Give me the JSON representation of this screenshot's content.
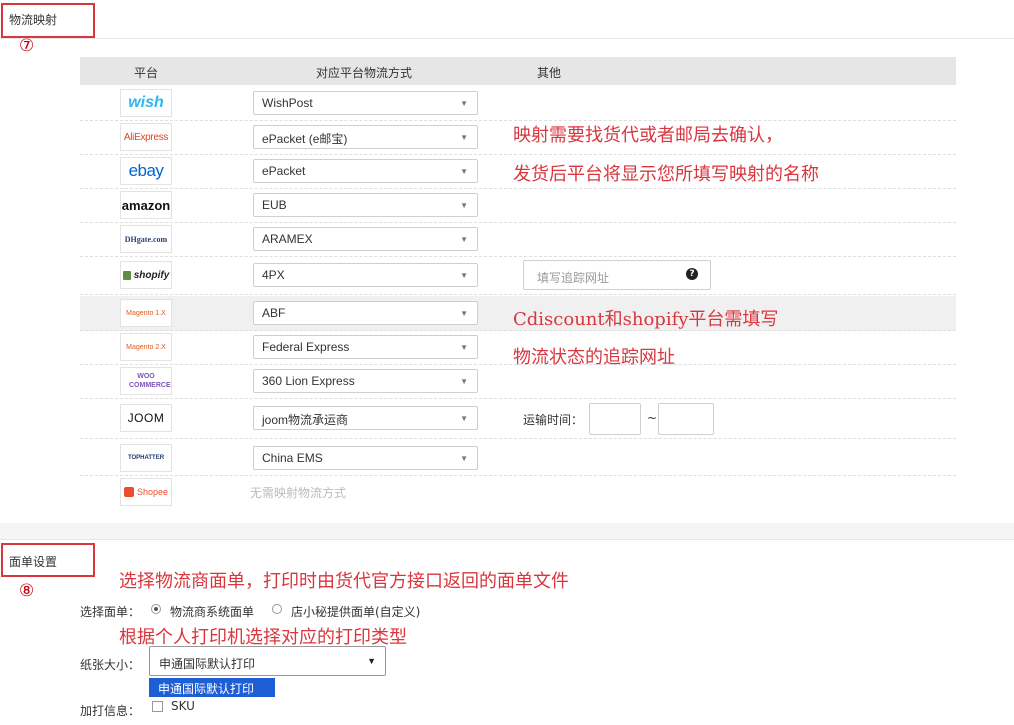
{
  "logistics_section": {
    "title": "物流映射",
    "step_marker": "⑦",
    "columns": {
      "platform": "平台",
      "method": "对应平台物流方式",
      "other": "其他"
    },
    "rows": [
      {
        "platform": "wish",
        "method": "WishPost"
      },
      {
        "platform": "AliExpress",
        "method": "ePacket (e邮宝)"
      },
      {
        "platform": "ebay",
        "method": "ePacket"
      },
      {
        "platform": "amazon",
        "method": "EUB"
      },
      {
        "platform": "DHgate.com",
        "method": "ARAMEX"
      },
      {
        "platform": "shopify",
        "method": "4PX"
      },
      {
        "platform": "Magento 1.X",
        "method": "ABF"
      },
      {
        "platform": "Magento 2.X",
        "method": "Federal Express"
      },
      {
        "platform": "WOO COMMERCE",
        "method": "360 Lion Express"
      },
      {
        "platform": "JOOM",
        "method": "joom物流承运商"
      },
      {
        "platform": "TOPHATTER",
        "method": "China EMS"
      },
      {
        "platform": "Shopee",
        "no_mapping": "无需映射物流方式"
      }
    ],
    "tracking_placeholder": "填写追踪网址",
    "transit_time_label": "运输时间：",
    "transit_sep": "~",
    "annotations": {
      "mapping_line1": "映射需要找货代或者邮局去确认，",
      "mapping_line2": "发货后平台将显示您所填写映射的名称",
      "tracking_line1": "Cdiscount和shopify平台需填写",
      "tracking_line2": "物流状态的追踪网址"
    }
  },
  "label_section": {
    "title": "面单设置",
    "step_marker": "⑧",
    "annotation_top": "选择物流商面单，打印时由货代官方接口返回的面单文件",
    "annotation_mid": "根据个人打印机选择对应的打印类型",
    "select_label": "选择面单：",
    "option_carrier": "物流商系统面单",
    "option_custom": "店小秘提供面单(自定义)",
    "paper_size_label": "纸张大小：",
    "paper_size_value": "申通国际默认打印",
    "paper_size_dropdown_option": "申通国际默认打印",
    "extra_print_label": "加打信息：",
    "extra_sku": "SKU"
  },
  "colors": {
    "annotation_red": "#d9363e",
    "dropdown_highlight": "#1e5fd6"
  }
}
